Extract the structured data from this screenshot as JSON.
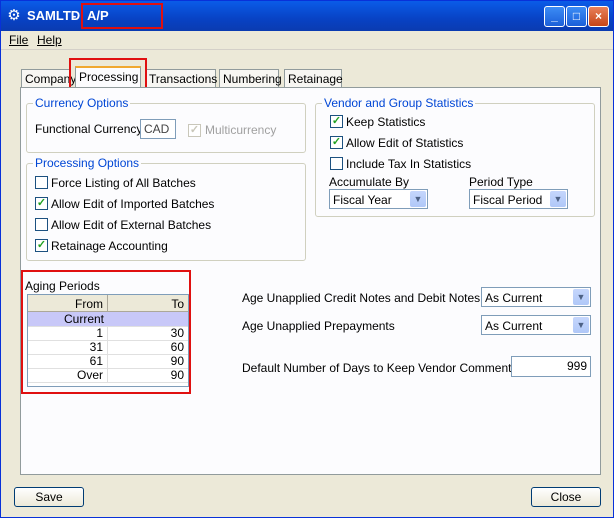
{
  "window": {
    "app_title": "SAMLTD",
    "separator": "-",
    "doc_title": "A/P Options",
    "minimize": "_",
    "maximize": "□",
    "close": "×"
  },
  "menu": [
    {
      "label": "File"
    },
    {
      "label": "Help"
    }
  ],
  "tabs": [
    "Company",
    "Processing",
    "Transactions",
    "Numbering",
    "Retainage"
  ],
  "currency": {
    "title": "Currency Options",
    "functional_label": "Functional Currency",
    "functional_value": "CAD",
    "multicurrency_label": "Multicurrency",
    "multicurrency_checked": true
  },
  "processing": {
    "title": "Processing Options",
    "options": [
      {
        "label": "Force Listing of All Batches",
        "checked": false
      },
      {
        "label": "Allow Edit of Imported Batches",
        "checked": true
      },
      {
        "label": "Allow Edit of External Batches",
        "checked": false
      },
      {
        "label": "Retainage Accounting",
        "checked": true
      }
    ]
  },
  "vendor_stats": {
    "title": "Vendor and Group Statistics",
    "options": [
      {
        "label": "Keep Statistics",
        "checked": true
      },
      {
        "label": "Allow Edit of Statistics",
        "checked": true
      },
      {
        "label": "Include Tax In Statistics",
        "checked": false
      }
    ],
    "accumulate_label": "Accumulate By",
    "accumulate_value": "Fiscal Year",
    "period_label": "Period Type",
    "period_value": "Fiscal Period"
  },
  "aging": {
    "title": "Aging Periods",
    "col_from": "From",
    "col_to": "To",
    "rows": [
      {
        "from": "Current",
        "to": ""
      },
      {
        "from": "1",
        "to": "30"
      },
      {
        "from": "31",
        "to": "60"
      },
      {
        "from": "61",
        "to": "90"
      },
      {
        "from": "Over",
        "to": "90"
      }
    ]
  },
  "age_settings": {
    "credit_label": "Age Unapplied Credit Notes and Debit Notes",
    "credit_value": "As Current",
    "prepay_label": "Age Unapplied Prepayments",
    "prepay_value": "As Current",
    "days_label": "Default Number of Days to Keep Vendor Comments",
    "days_value": "999"
  },
  "buttons": {
    "save": "Save",
    "close": "Close"
  },
  "colors": {
    "accent_red": "#e01010",
    "group_title_blue": "#0046d5",
    "titlebar_blue": "#0a5ce8"
  }
}
